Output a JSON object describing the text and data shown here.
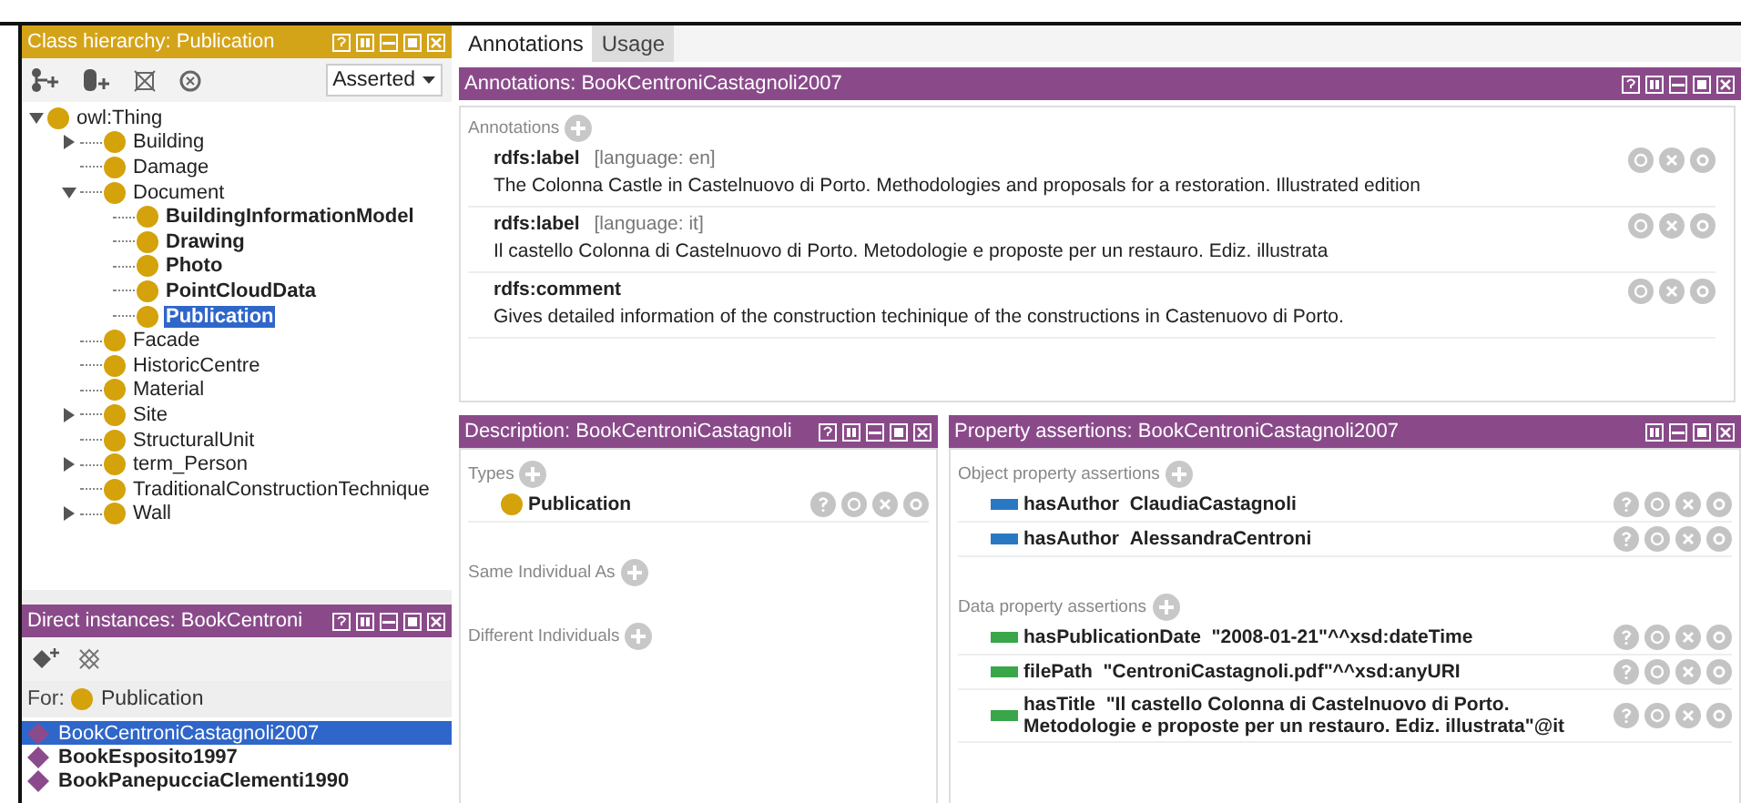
{
  "class_hierarchy": {
    "title": "Class hierarchy: Publication",
    "view": "Asserted",
    "tree": [
      {
        "label": "owl:Thing",
        "expanded": true,
        "bold": false,
        "selected": false,
        "children": [
          {
            "label": "Building",
            "expanded": false,
            "bold": false,
            "selected": false
          },
          {
            "label": "Damage",
            "bold": false,
            "selected": false
          },
          {
            "label": "Document",
            "expanded": true,
            "bold": false,
            "selected": false,
            "children": [
              {
                "label": "BuildingInformationModel",
                "bold": true,
                "selected": false
              },
              {
                "label": "Drawing",
                "bold": true,
                "selected": false
              },
              {
                "label": "Photo",
                "bold": true,
                "selected": false
              },
              {
                "label": "PointCloudData",
                "bold": true,
                "selected": false
              },
              {
                "label": "Publication",
                "bold": true,
                "selected": true
              }
            ]
          },
          {
            "label": "Facade",
            "bold": false,
            "selected": false
          },
          {
            "label": "HistoricCentre",
            "bold": false,
            "selected": false
          },
          {
            "label": "Material",
            "bold": false,
            "selected": false
          },
          {
            "label": "Site",
            "expanded": false,
            "bold": false,
            "selected": false
          },
          {
            "label": "StructuralUnit",
            "bold": false,
            "selected": false
          },
          {
            "label": "term_Person",
            "expanded": false,
            "bold": false,
            "selected": false
          },
          {
            "label": "TraditionalConstructionTechnique",
            "bold": false,
            "selected": false
          },
          {
            "label": "Wall",
            "expanded": false,
            "bold": false,
            "selected": false
          }
        ]
      }
    ]
  },
  "direct_instances": {
    "title": "Direct instances: BookCentroni",
    "for_label": "For:",
    "for_class": "Publication",
    "items": [
      {
        "label": "BookCentroniCastagnoli2007",
        "selected": true
      },
      {
        "label": "BookEsposito1997",
        "selected": false
      },
      {
        "label": "BookPanepucciaClementi1990",
        "selected": false
      }
    ]
  },
  "tabs": [
    {
      "label": "Annotations",
      "selected": true
    },
    {
      "label": "Usage",
      "selected": false
    }
  ],
  "annotations": {
    "title": "Annotations: BookCentroniCastagnoli2007",
    "section": "Annotations",
    "items": [
      {
        "property": "rdfs:label",
        "language": "[language: en]",
        "value": "The Colonna Castle in Castelnuovo di Porto. Methodologies and proposals for a restoration. Illustrated edition"
      },
      {
        "property": "rdfs:label",
        "language": "[language: it]",
        "value": "Il castello Colonna di Castelnuovo di Porto. Metodologie e proposte per un restauro. Ediz. illustrata"
      },
      {
        "property": "rdfs:comment",
        "value": "Gives detailed information of the construction techinique of the constructions in Castenuovo di Porto."
      }
    ]
  },
  "description": {
    "title": "Description: BookCentroniCastagnoli",
    "types_label": "Types",
    "types": [
      "Publication"
    ],
    "same_label": "Same Individual As",
    "different_label": "Different Individuals"
  },
  "property_assertions": {
    "title": "Property assertions: BookCentroniCastagnoli2007",
    "object_label": "Object property assertions",
    "object_items": [
      {
        "property": "hasAuthor",
        "value": "ClaudiaCastagnoli"
      },
      {
        "property": "hasAuthor",
        "value": "AlessandraCentroni"
      }
    ],
    "data_label": "Data property assertions",
    "data_items": [
      {
        "property": "hasPublicationDate",
        "value": "\"2008-01-21\"^^xsd:dateTime"
      },
      {
        "property": "filePath",
        "value": "\"CentroniCastagnoli.pdf\"^^xsd:anyURI"
      },
      {
        "property": "hasTitle",
        "value": "\"Il castello Colonna di Castelnuovo di Porto. Metodologie e proposte per un restauro. Ediz. illustrata\"@it"
      }
    ]
  }
}
